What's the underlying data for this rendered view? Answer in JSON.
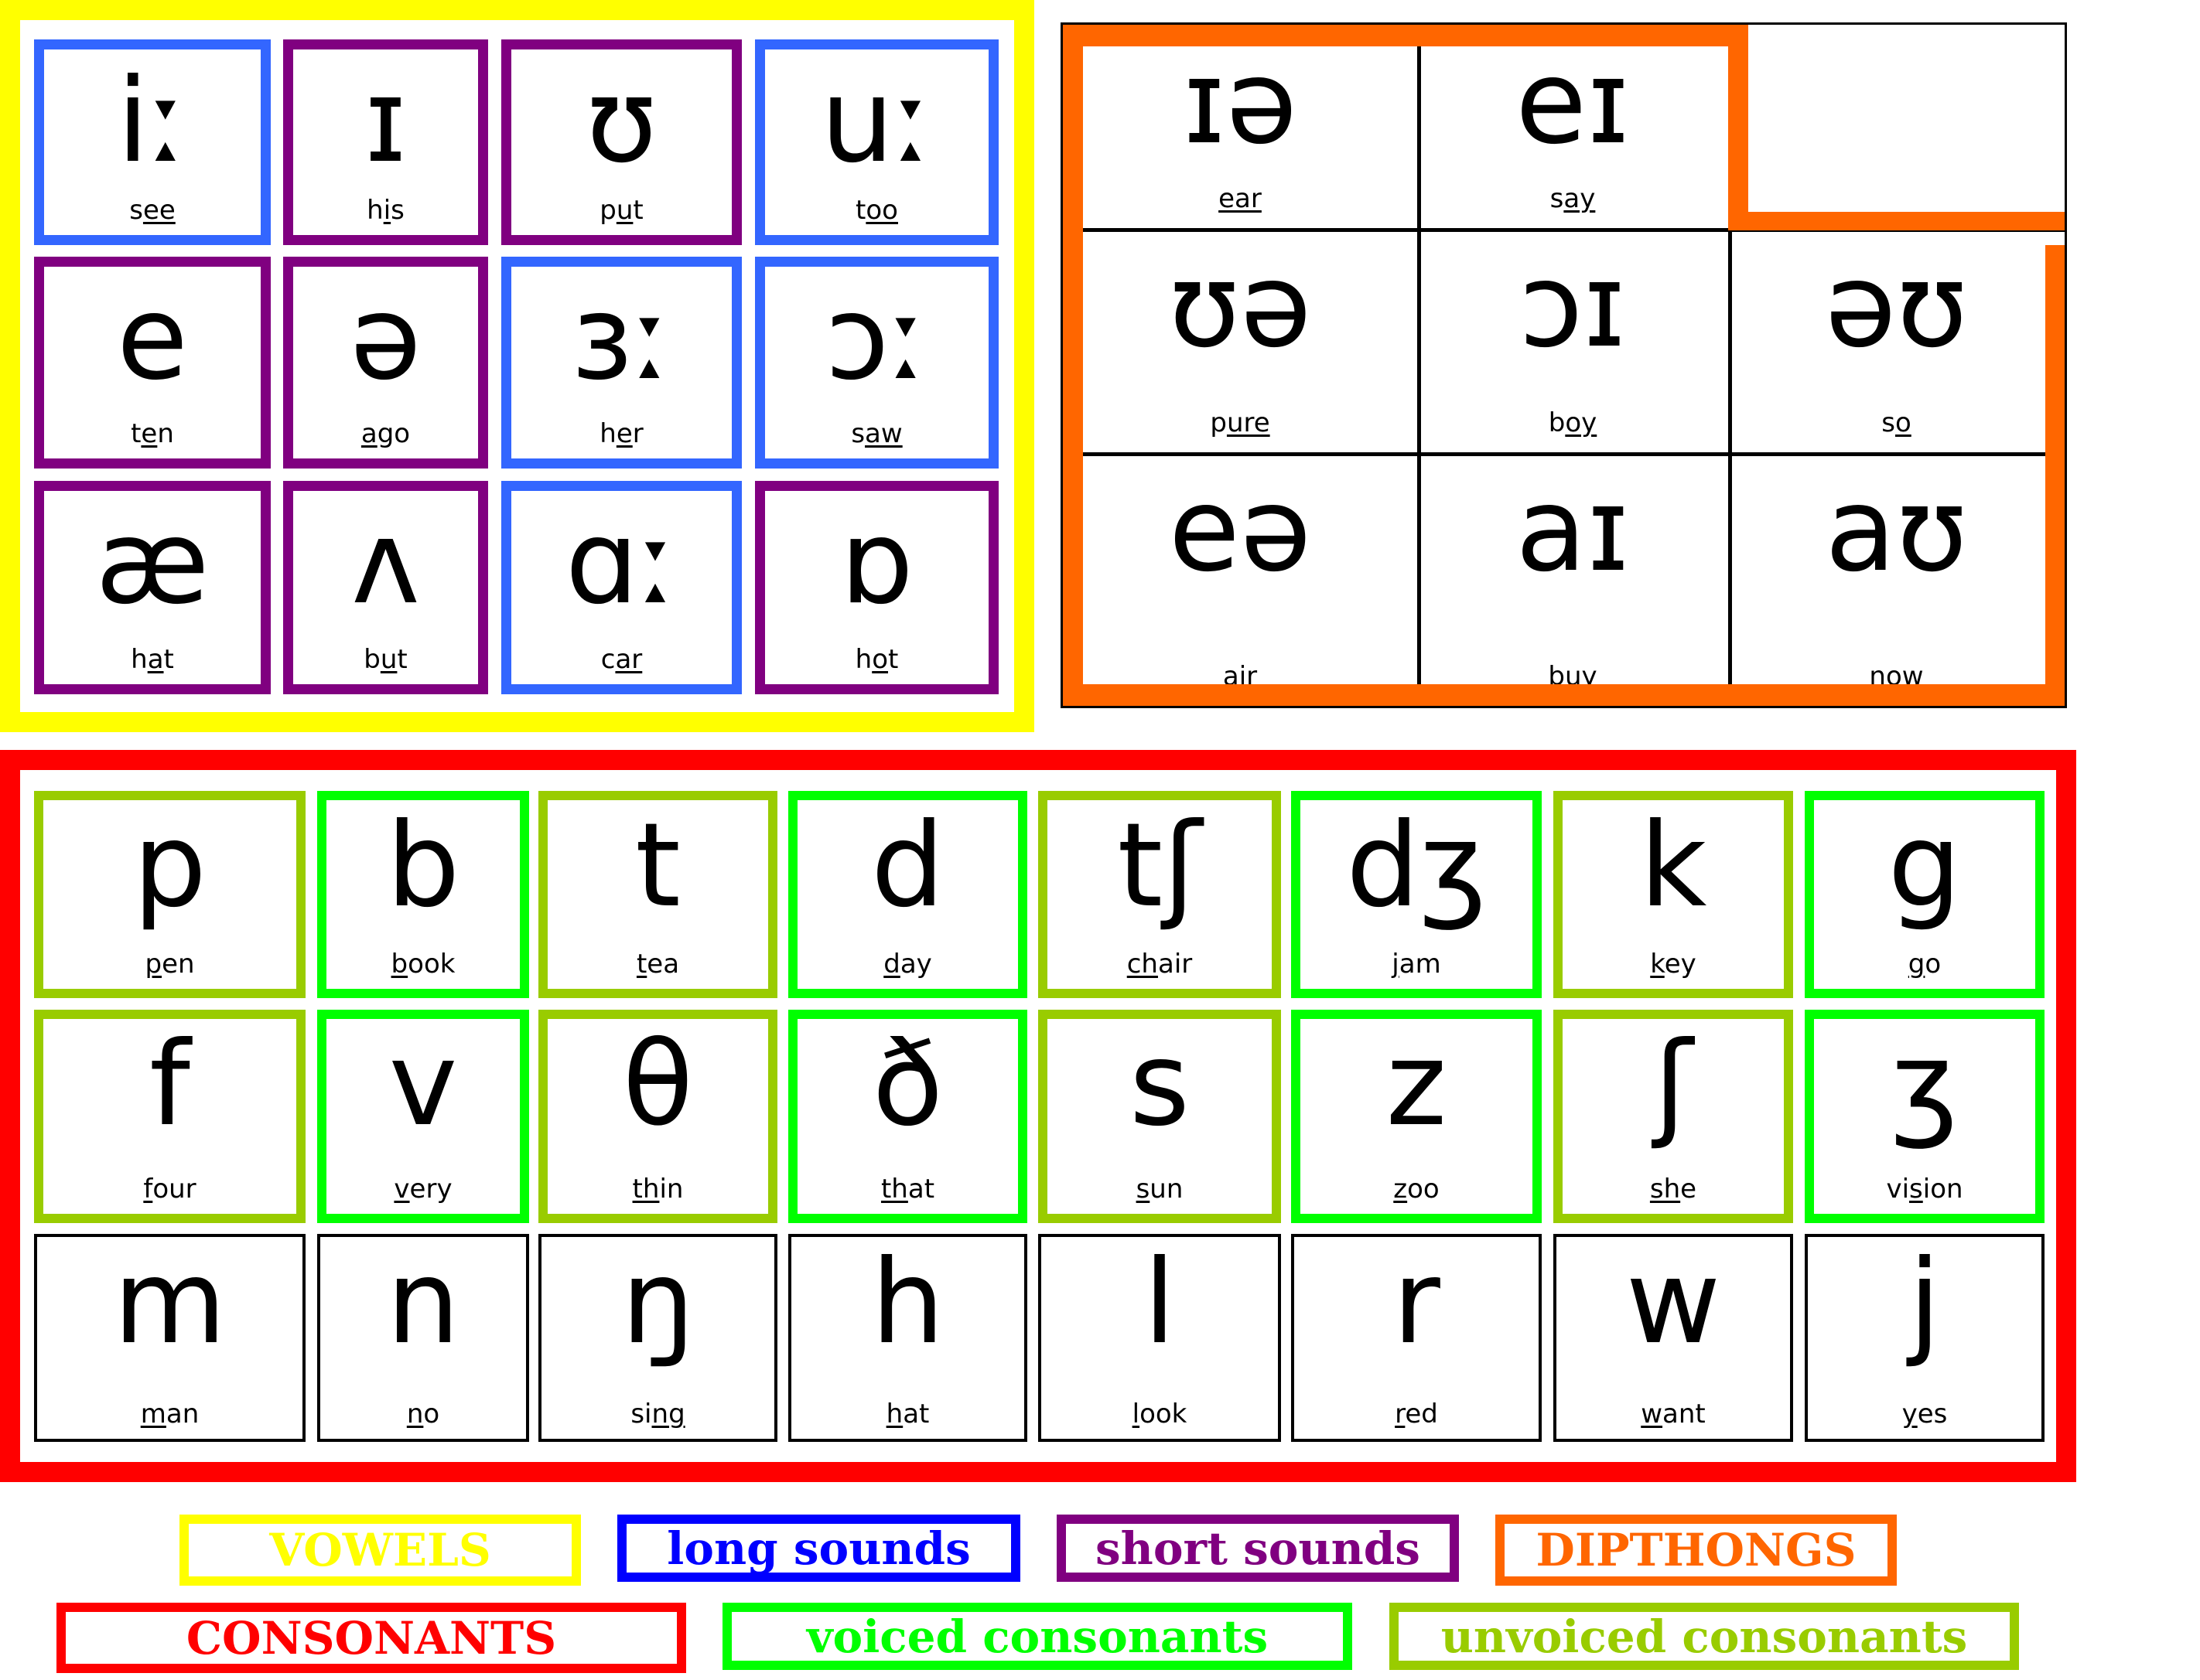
{
  "colors": {
    "vowels": "#ffff00",
    "long": "#3366ff",
    "short": "#800080",
    "diphthongs": "#ff6600",
    "consonants": "#ff0000",
    "voiced": "#00ff00",
    "unvoiced": "#99cc00",
    "plain": "#000000"
  },
  "vowels": [
    {
      "symbol": "iː",
      "word_pre": "s",
      "word_u": "ee",
      "word_post": "",
      "type": "long"
    },
    {
      "symbol": "ɪ",
      "word_pre": "h",
      "word_u": "i",
      "word_post": "s",
      "type": "short"
    },
    {
      "symbol": "ʊ",
      "word_pre": "p",
      "word_u": "u",
      "word_post": "t",
      "type": "short"
    },
    {
      "symbol": "uː",
      "word_pre": "t",
      "word_u": "oo",
      "word_post": "",
      "type": "long"
    },
    {
      "symbol": "e",
      "word_pre": "t",
      "word_u": "e",
      "word_post": "n",
      "type": "short"
    },
    {
      "symbol": "ə",
      "word_pre": "",
      "word_u": "a",
      "word_post": "go",
      "type": "short"
    },
    {
      "symbol": "ɜː",
      "word_pre": "h",
      "word_u": "e",
      "word_post": "r",
      "type": "long"
    },
    {
      "symbol": "ɔː",
      "word_pre": "s",
      "word_u": "aw",
      "word_post": "",
      "type": "long"
    },
    {
      "symbol": "æ",
      "word_pre": "h",
      "word_u": "a",
      "word_post": "t",
      "type": "short"
    },
    {
      "symbol": "ʌ",
      "word_pre": "b",
      "word_u": "u",
      "word_post": "t",
      "type": "short"
    },
    {
      "symbol": "ɑː",
      "word_pre": "c",
      "word_u": "ar",
      "word_post": "",
      "type": "long"
    },
    {
      "symbol": "ɒ",
      "word_pre": "h",
      "word_u": "o",
      "word_post": "t",
      "type": "short"
    }
  ],
  "diphthongs": [
    {
      "symbol": "ɪə",
      "word_pre": "",
      "word_u": "ear",
      "word_post": ""
    },
    {
      "symbol": "eɪ",
      "word_pre": "s",
      "word_u": "ay",
      "word_post": ""
    },
    {
      "symbol": "",
      "word_pre": "",
      "word_u": "",
      "word_post": ""
    },
    {
      "symbol": "ʊə",
      "word_pre": "p",
      "word_u": "ure",
      "word_post": ""
    },
    {
      "symbol": "ɔɪ",
      "word_pre": "b",
      "word_u": "oy",
      "word_post": ""
    },
    {
      "symbol": "əʊ",
      "word_pre": "s",
      "word_u": "o",
      "word_post": ""
    },
    {
      "symbol": "eə",
      "word_pre": "",
      "word_u": "air",
      "word_post": ""
    },
    {
      "symbol": "aɪ",
      "word_pre": "b",
      "word_u": "uy",
      "word_post": ""
    },
    {
      "symbol": "aʊ",
      "word_pre": "n",
      "word_u": "ow",
      "word_post": ""
    }
  ],
  "consonants": [
    {
      "symbol": "p",
      "word_pre": "",
      "word_u": "p",
      "word_post": "en",
      "type": "unvoiced"
    },
    {
      "symbol": "b",
      "word_pre": "",
      "word_u": "b",
      "word_post": "ook",
      "type": "voiced"
    },
    {
      "symbol": "t",
      "word_pre": "",
      "word_u": "t",
      "word_post": "ea",
      "type": "unvoiced"
    },
    {
      "symbol": "d",
      "word_pre": "",
      "word_u": "d",
      "word_post": "ay",
      "type": "voiced"
    },
    {
      "symbol": "tʃ",
      "word_pre": "",
      "word_u": "ch",
      "word_post": "air",
      "type": "unvoiced"
    },
    {
      "symbol": "dʒ",
      "word_pre": "",
      "word_u": "j",
      "word_post": "am",
      "type": "voiced"
    },
    {
      "symbol": "k",
      "word_pre": "",
      "word_u": "k",
      "word_post": "ey",
      "type": "unvoiced"
    },
    {
      "symbol": "g",
      "word_pre": "",
      "word_u": "g",
      "word_post": "o",
      "type": "voiced"
    },
    {
      "symbol": "f",
      "word_pre": "",
      "word_u": "f",
      "word_post": "our",
      "type": "unvoiced"
    },
    {
      "symbol": "v",
      "word_pre": "",
      "word_u": "v",
      "word_post": "ery",
      "type": "voiced"
    },
    {
      "symbol": "θ",
      "word_pre": "",
      "word_u": "th",
      "word_post": "in",
      "type": "unvoiced"
    },
    {
      "symbol": "ð",
      "word_pre": "",
      "word_u": "th",
      "word_post": "at",
      "type": "voiced"
    },
    {
      "symbol": "s",
      "word_pre": "",
      "word_u": "s",
      "word_post": "un",
      "type": "unvoiced"
    },
    {
      "symbol": "z",
      "word_pre": "",
      "word_u": "z",
      "word_post": "oo",
      "type": "voiced"
    },
    {
      "symbol": "ʃ",
      "word_pre": "",
      "word_u": "sh",
      "word_post": "e",
      "type": "unvoiced"
    },
    {
      "symbol": "ʒ",
      "word_pre": "vi",
      "word_u": "s",
      "word_post": "ion",
      "type": "voiced"
    },
    {
      "symbol": "m",
      "word_pre": "",
      "word_u": "m",
      "word_post": "an",
      "type": "plain"
    },
    {
      "symbol": "n",
      "word_pre": "",
      "word_u": "n",
      "word_post": "o",
      "type": "plain"
    },
    {
      "symbol": "ŋ",
      "word_pre": "si",
      "word_u": "ng",
      "word_post": "",
      "type": "plain"
    },
    {
      "symbol": "h",
      "word_pre": "",
      "word_u": "h",
      "word_post": "at",
      "type": "plain"
    },
    {
      "symbol": "l",
      "word_pre": "",
      "word_u": "l",
      "word_post": "ook",
      "type": "plain"
    },
    {
      "symbol": "r",
      "word_pre": "",
      "word_u": "r",
      "word_post": "ed",
      "type": "plain"
    },
    {
      "symbol": "w",
      "word_pre": "",
      "word_u": "w",
      "word_post": "ant",
      "type": "plain"
    },
    {
      "symbol": "j",
      "word_pre": "",
      "word_u": "y",
      "word_post": "es",
      "type": "plain"
    }
  ],
  "legend": [
    {
      "label": "VOWELS",
      "color": "#ffff00"
    },
    {
      "label": "long sounds",
      "color": "#0000ff"
    },
    {
      "label": "short sounds",
      "color": "#800080"
    },
    {
      "label": "DIPTHONGS",
      "color": "#ff6600"
    },
    {
      "label": "CONSONANTS",
      "color": "#ff0000"
    },
    {
      "label": "voiced consonants",
      "color": "#00ff00"
    },
    {
      "label": "unvoiced consonants",
      "color": "#99cc00"
    }
  ]
}
